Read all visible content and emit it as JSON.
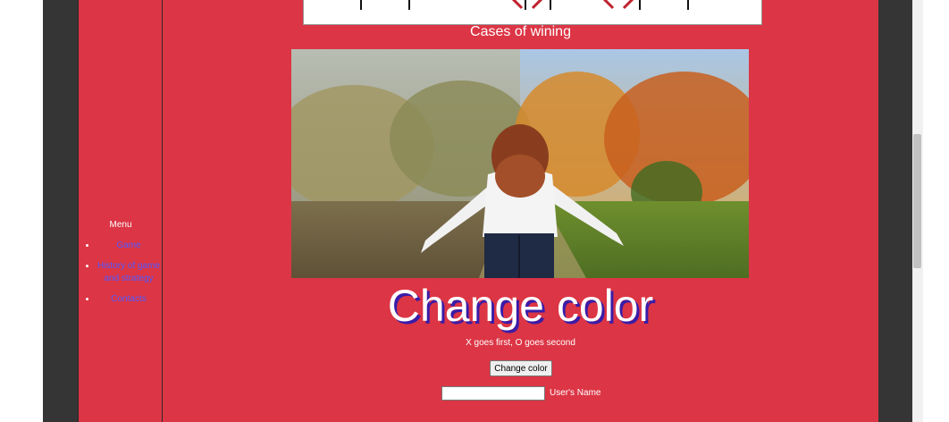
{
  "game_section": {
    "caption": "Cases of wining"
  },
  "menu": {
    "title": "Menu",
    "items": [
      {
        "label": "Game"
      },
      {
        "label": "History of game and strategy"
      },
      {
        "label": "Contacts"
      }
    ]
  },
  "main": {
    "headline": "Change color",
    "info": "X goes first, O goes second",
    "change_color_button": "Change color",
    "user_name_label": "User's Name",
    "user_name_value": ""
  },
  "colors": {
    "page_background": "#dc3545",
    "side_panels": "#353535",
    "link": "#4f57ff",
    "headline_shadow": "#3a1ca8"
  }
}
